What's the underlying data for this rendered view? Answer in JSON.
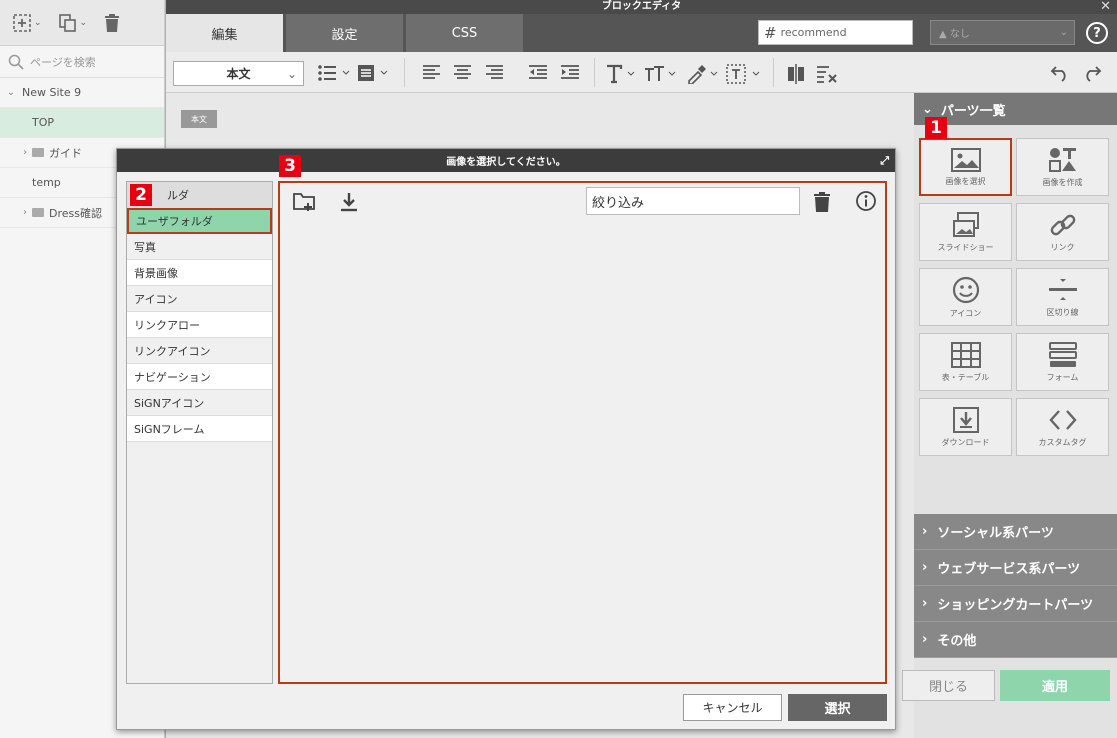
{
  "window": {
    "title": "ブロックエディタ",
    "close": "✕"
  },
  "sidebar": {
    "search_placeholder": "ページを検索",
    "tree": [
      {
        "label": "New Site 9",
        "indent": 0,
        "chevron": "⌄",
        "folder": false
      },
      {
        "label": "TOP",
        "indent": 1,
        "selected": true,
        "folder": false
      },
      {
        "label": "ガイド",
        "indent": 1,
        "chevron": "›",
        "folder": true
      },
      {
        "label": "temp",
        "indent": 1,
        "folder": false
      },
      {
        "label": "Dress確認",
        "indent": 1,
        "chevron": "›",
        "folder": true
      }
    ]
  },
  "tabs": [
    {
      "label": "編集",
      "active": true
    },
    {
      "label": "設定",
      "active": false
    },
    {
      "label": "CSS",
      "active": false
    }
  ],
  "header": {
    "tag_value": "recommend",
    "tag_prefix": "#",
    "select_value": "なし",
    "help": "?"
  },
  "toolbar": {
    "style_select": "本文"
  },
  "editor": {
    "block_label": "本文"
  },
  "right_panel": {
    "heading": "パーツ一覧",
    "parts": [
      {
        "label": "画像を選択",
        "icon": "image-icon",
        "highlight": true
      },
      {
        "label": "画像を作成",
        "icon": "shapes-icon"
      },
      {
        "label": "スライドショー",
        "icon": "slideshow-icon"
      },
      {
        "label": "リンク",
        "icon": "link-icon"
      },
      {
        "label": "アイコン",
        "icon": "smiley-icon"
      },
      {
        "label": "区切り線",
        "icon": "divider-icon"
      },
      {
        "label": "表・テーブル",
        "icon": "table-icon"
      },
      {
        "label": "フォーム",
        "icon": "form-icon"
      },
      {
        "label": "ダウンロード",
        "icon": "download-icon"
      },
      {
        "label": "カスタムタグ",
        "icon": "code-icon"
      }
    ],
    "accordions": [
      "ソーシャル系パーツ",
      "ウェブサービス系パーツ",
      "ショッピングカートパーツ",
      "その他"
    ],
    "close_button": "閉じる",
    "apply_button": "適用"
  },
  "modal": {
    "title": "画像を選択してください。",
    "folder_header": "ルダ",
    "folders": [
      {
        "label": "ユーザフォルダ",
        "selected": true
      },
      {
        "label": "写真"
      },
      {
        "label": "背景画像"
      },
      {
        "label": "アイコン"
      },
      {
        "label": "リンクアロー"
      },
      {
        "label": "リンクアイコン"
      },
      {
        "label": "ナビゲーション"
      },
      {
        "label": "SiGNアイコン"
      },
      {
        "label": "SiGNフレーム"
      }
    ],
    "filter_value": "絞り込み",
    "cancel_button": "キャンセル",
    "select_button": "選択"
  },
  "markers": [
    "1",
    "2",
    "3"
  ],
  "colors": {
    "highlight": "#b33d1b",
    "marker": "#e60012",
    "selected_green": "#8fd5ac",
    "apply_green": "#8fd5ac"
  }
}
